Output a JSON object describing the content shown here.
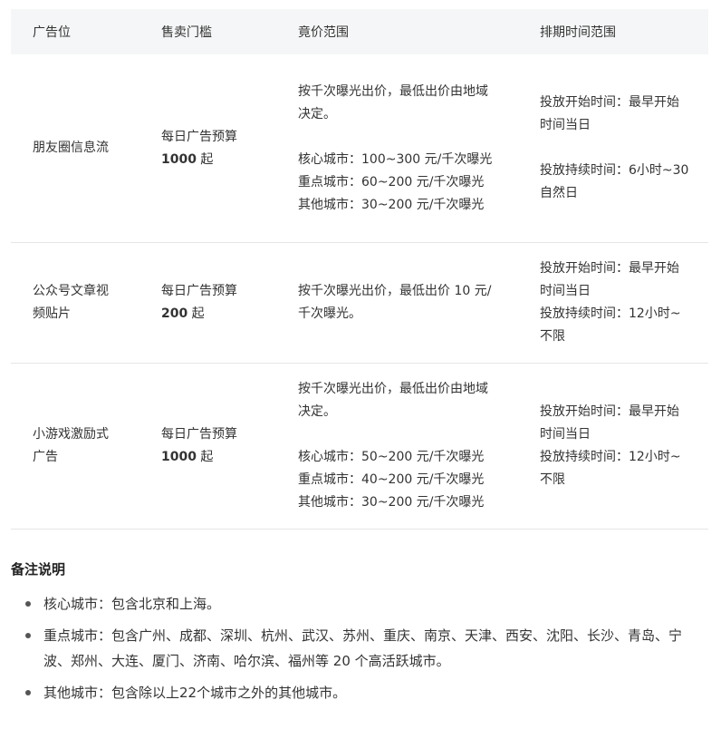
{
  "table": {
    "headers": [
      "广告位",
      "售卖门槛",
      "竟价范围",
      "排期时间范围"
    ],
    "rows": [
      {
        "slot": "朋友圈信息流",
        "threshold_line1": "每日广告预算",
        "threshold_amount": "1000",
        "threshold_suffix": " 起",
        "bid_lines": [
          "按千次曝光出价，最低出价由地域",
          "决定。",
          "",
          "核心城市：100~300 元/千次曝光",
          "重点城市：60~200 元/千次曝光",
          "其他城市：30~200 元/千次曝光"
        ],
        "schedule_lines": [
          "投放开始时间：最早开始",
          "时间当日",
          "",
          "投放持续时间：6小时~30",
          "自然日"
        ]
      },
      {
        "slot_line1": "公众号文章视",
        "slot_line2": "频贴片",
        "threshold_line1": "每日广告预算",
        "threshold_amount": "200",
        "threshold_suffix": " 起",
        "bid_lines": [
          "按千次曝光出价，最低出价 10 元/",
          "千次曝光。"
        ],
        "schedule_lines": [
          "投放开始时间：最早开始",
          "时间当日",
          "投放持续时间：12小时~",
          "不限"
        ]
      },
      {
        "slot_line1": "小游戏激励式",
        "slot_line2": "广告",
        "threshold_line1": "每日广告预算",
        "threshold_amount": "1000",
        "threshold_suffix": " 起",
        "bid_lines": [
          "按千次曝光出价，最低出价由地域",
          "决定。",
          "",
          "核心城市：50~200 元/千次曝光",
          "重点城市：40~200 元/千次曝光",
          "其他城市：30~200 元/千次曝光"
        ],
        "schedule_lines": [
          "投放开始时间：最早开始",
          "时间当日",
          "投放持续时间：12小时~",
          "不限"
        ]
      }
    ]
  },
  "notes": {
    "title": "备注说明",
    "items": [
      "核心城市：包含北京和上海。",
      "重点城市：包含广州、成都、深圳、杭州、武汉、苏州、重庆、南京、天津、西安、沈阳、长沙、青岛、宁波、郑州、大连、厦门、济南、哈尔滨、福州等 20 个高活跃城市。",
      "其他城市：包含除以上22个城市之外的其他城市。"
    ]
  }
}
